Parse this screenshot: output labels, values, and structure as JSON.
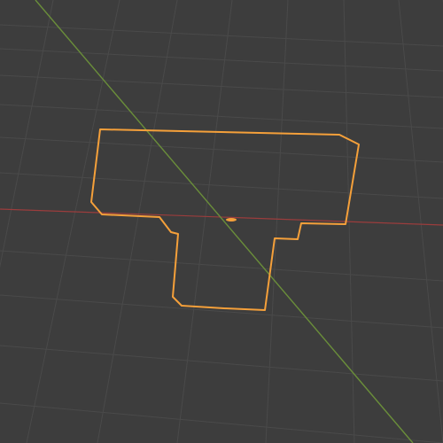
{
  "viewport": {
    "background": "#3d3d3d",
    "grid_color": "#4a4a4a",
    "x_axis_color": "#9b3d3d",
    "y_axis_color": "#6a8e3a",
    "selection_color": "#f5a03a",
    "view": "perspective",
    "grid": "on"
  },
  "object": {
    "type": "outline-mesh",
    "selected": true,
    "origin_icon": "origin-dot-icon"
  }
}
